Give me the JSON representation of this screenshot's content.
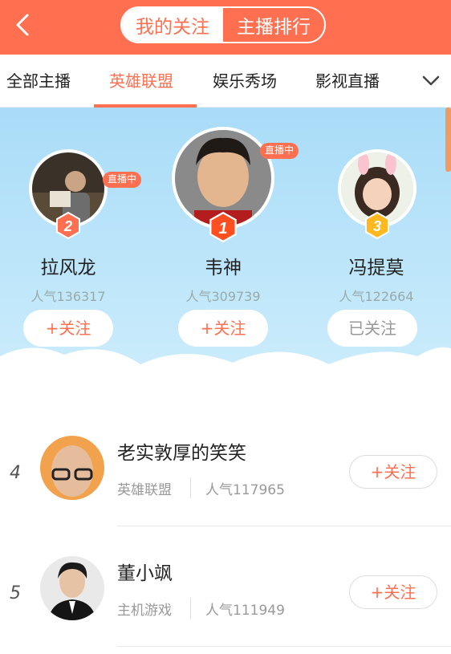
{
  "header": {
    "back_icon": "chevron-left-icon",
    "segments": [
      "我的关注",
      "主播排行"
    ],
    "active_segment": "我的关注"
  },
  "tabs": {
    "items": [
      "全部主播",
      "英雄联盟",
      "娱乐秀场",
      "影视直播"
    ],
    "active": "英雄联盟",
    "more_icon": "chevron-down-icon"
  },
  "podium": [
    {
      "rank": "2",
      "name": "拉风龙",
      "popularity": "人气136317",
      "live_tag": "直播中",
      "button": "+关注",
      "badge_color": "#ff6f50"
    },
    {
      "rank": "1",
      "name": "韦神",
      "popularity": "人气309739",
      "live_tag": "直播中",
      "button": "+关注",
      "badge_color": "#ff4e1f"
    },
    {
      "rank": "3",
      "name": "冯提莫",
      "popularity": "人气122664",
      "live_tag": "",
      "button": "已关注",
      "badge_color": "#ffb81f"
    }
  ],
  "list": [
    {
      "rank": "4",
      "name": "老实敦厚的笑笑",
      "category": "英雄联盟",
      "popularity": "人气117965",
      "button": "+关注"
    },
    {
      "rank": "5",
      "name": "董小飒",
      "category": "主机游戏",
      "popularity": "人气111949",
      "button": "+关注"
    }
  ],
  "colors": {
    "accent": "#ff6f50",
    "sky_top": "#a9dcf8",
    "sky_bottom": "#cfeefc"
  }
}
